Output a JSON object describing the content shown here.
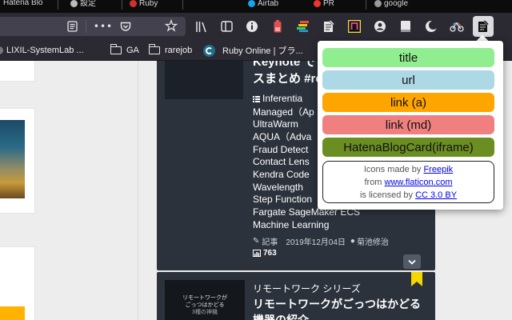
{
  "tabs": [
    {
      "label": "Hatena Blo"
    },
    {
      "label": "設定"
    },
    {
      "label": "Ruby"
    },
    {
      "label": "Airtab"
    },
    {
      "label": "PR"
    },
    {
      "label": "google"
    }
  ],
  "toolbar": {
    "reader_icon": "reader-view-icon",
    "menu_dots": "•••",
    "pocket_icon": "pocket-icon",
    "star_icon": "★",
    "library_icon": "library-icon",
    "sidebar_icon": "sidebar-icon",
    "colors": {
      "active_ext_bg": "#dadadf",
      "toolbar_bg": "#2b2a33"
    }
  },
  "bookmarks": [
    {
      "label": "LIXIL-SystemLab ...",
      "icon": "globe-icon"
    },
    {
      "label": "GA",
      "icon": "folder-icon"
    },
    {
      "label": "rarejob",
      "icon": "folder-icon"
    },
    {
      "label": "Ruby Online | ブラ...",
      "icon": "ruby-online-icon"
    }
  ],
  "feed": {
    "entry1": {
      "title_line1": "Keynote で",
      "title_line2": "スまとめ #re",
      "category_icon": "list-icon",
      "lines": [
        "Inferentia",
        "Managed（Ap",
        "UltraWarm",
        "AQUA（Adva",
        "Fraud Detect",
        "Contact Lens",
        "Kendra  Code",
        "Wavelength",
        "Step Function",
        "Fargate  SageMaker  ECS",
        "Machine Learning"
      ],
      "meta_kind": "記事",
      "meta_date": "2019年12月04日",
      "meta_author": "菊池修治",
      "views": "763"
    },
    "entry2": {
      "series": "リモートワーク シリーズ",
      "title_line1": "リモートワークがごっつはかどる",
      "title_line2": "機器の紹介",
      "thumb_line1": "リモートワークが",
      "thumb_line2": "ごっつはかどる",
      "thumb_line3": "3種の神機"
    }
  },
  "popup": {
    "buttons": [
      {
        "label": "title",
        "color": "#90ee90"
      },
      {
        "label": "url",
        "color": "#add8e6"
      },
      {
        "label": "link (a)",
        "color": "#ffa500"
      },
      {
        "label": "link (md)",
        "color": "#f08080"
      },
      {
        "label": "HatenaBlogCard(iframe)",
        "color": "#6b8e23"
      }
    ],
    "credits": {
      "line1_prefix": "Icons made by ",
      "line1_link": "Freepik",
      "line2_prefix": "from ",
      "line2_link": "www.flaticon.com",
      "line3_prefix": "is licensed by ",
      "line3_link": "CC 3.0 BY"
    }
  }
}
